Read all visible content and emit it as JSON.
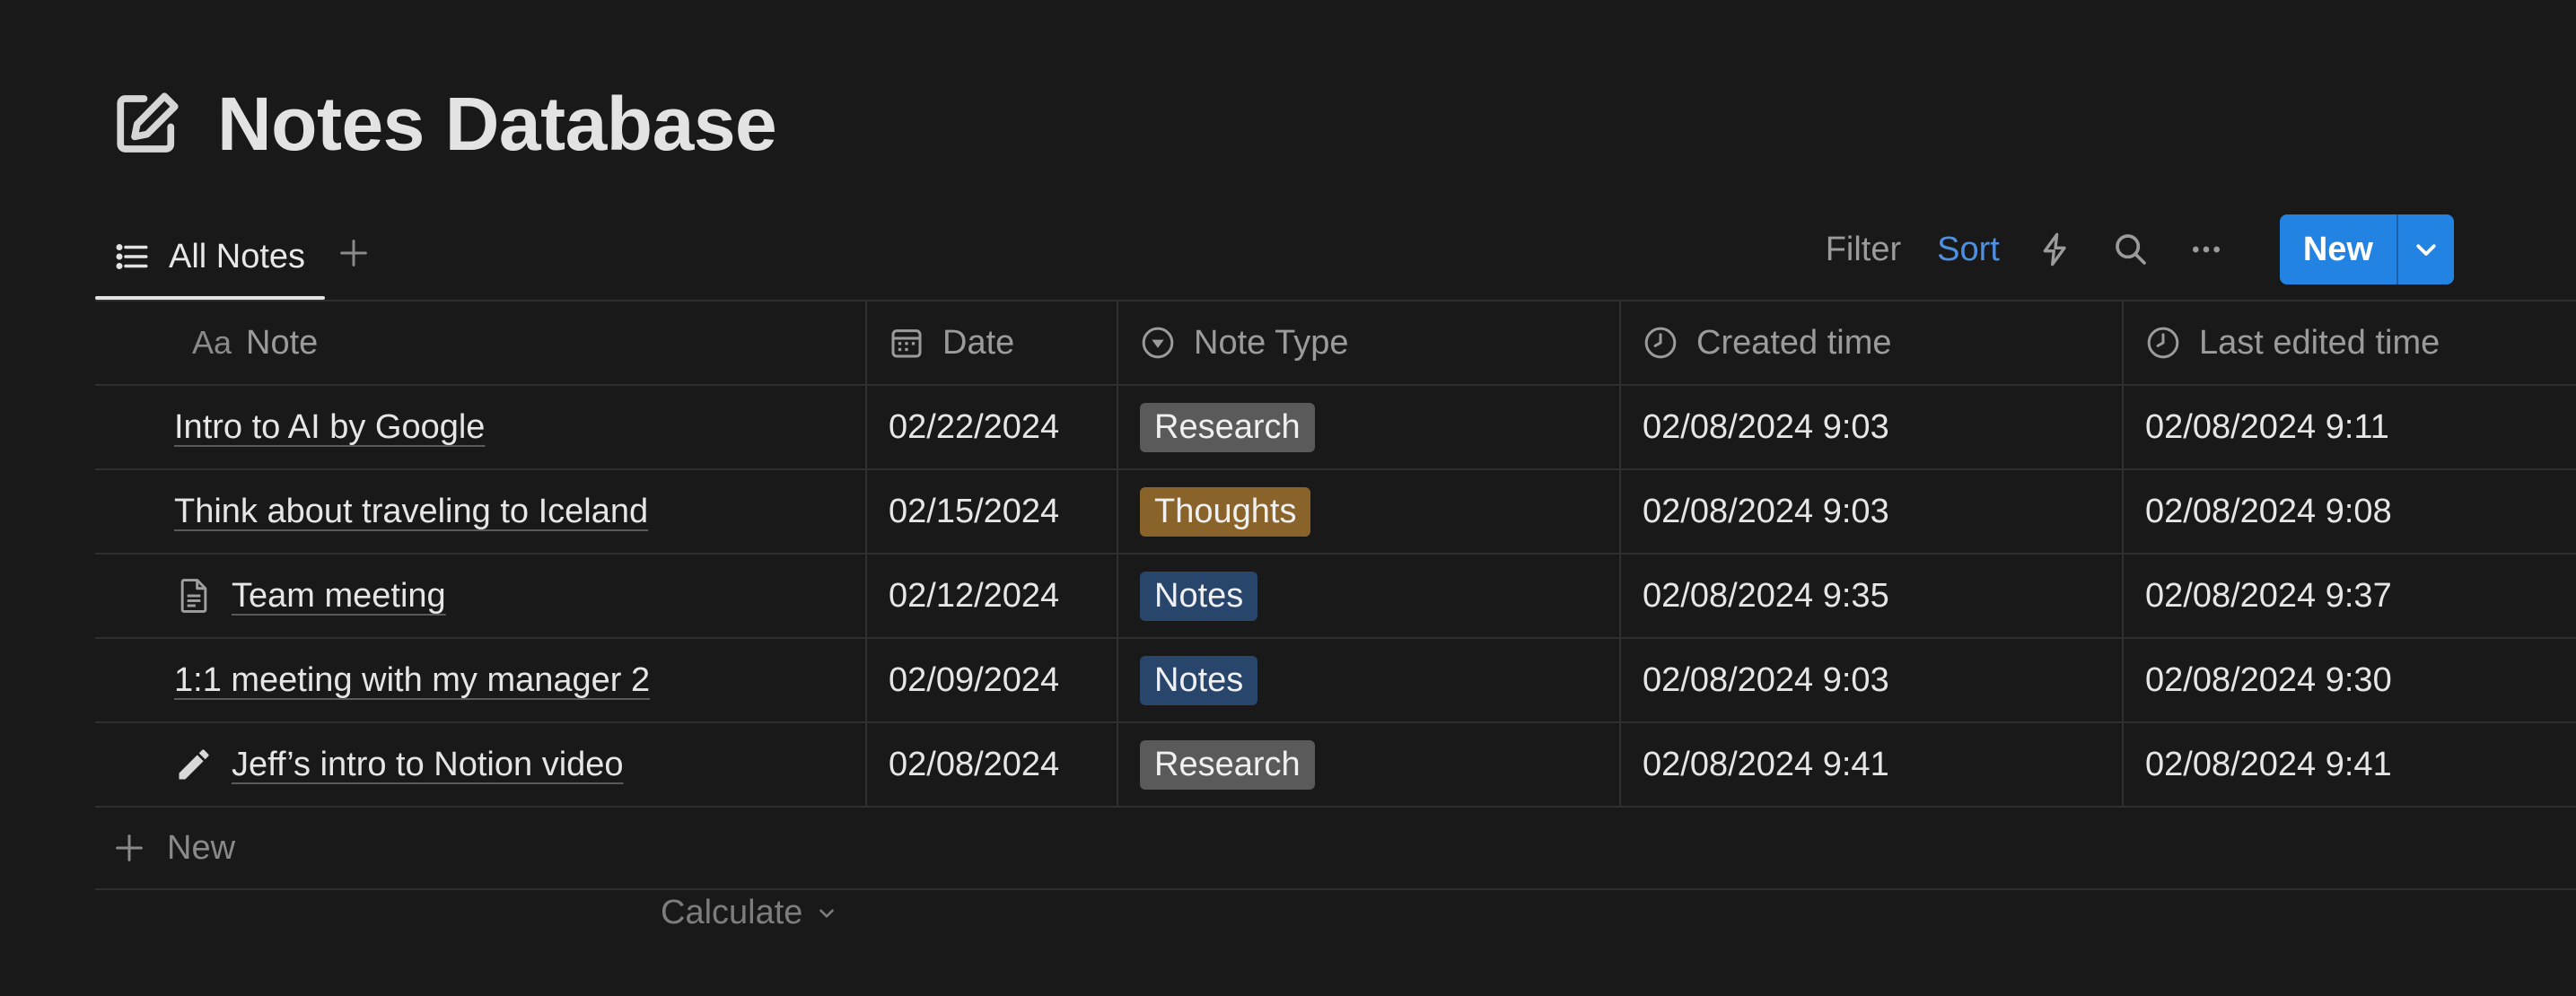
{
  "page": {
    "title": "Notes Database",
    "icon": "edit-note-icon"
  },
  "views": {
    "tabs": [
      {
        "label": "All Notes",
        "icon": "list-icon"
      }
    ],
    "add_view_icon": "plus-icon"
  },
  "toolbar": {
    "filter_label": "Filter",
    "sort_label": "Sort",
    "automation_icon": "lightning-icon",
    "search_icon": "search-icon",
    "more_icon": "ellipsis-icon",
    "new_label": "New",
    "new_menu_icon": "chevron-down-icon",
    "accent_color": "#2383e2",
    "sort_color": "#4f8fe0"
  },
  "table": {
    "columns": [
      {
        "label": "Note",
        "prefix": "Aa"
      },
      {
        "label": "Date",
        "icon": "calendar-icon"
      },
      {
        "label": "Note Type",
        "icon": "select-icon"
      },
      {
        "label": "Created time",
        "icon": "clock-icon"
      },
      {
        "label": "Last edited time",
        "icon": "clock-icon"
      }
    ],
    "rows": [
      {
        "note": "Intro to AI by Google",
        "icon": "",
        "date": "02/22/2024",
        "type": "Research",
        "created": "02/08/2024 9:03",
        "edited": "02/08/2024 9:11"
      },
      {
        "note": "Think about traveling to Iceland",
        "icon": "",
        "date": "02/15/2024",
        "type": "Thoughts",
        "created": "02/08/2024 9:03",
        "edited": "02/08/2024 9:08"
      },
      {
        "note": "Team meeting",
        "icon": "document-icon",
        "date": "02/12/2024",
        "type": "Notes",
        "created": "02/08/2024 9:35",
        "edited": "02/08/2024 9:37"
      },
      {
        "note": "1:1 meeting with my manager 2",
        "icon": "",
        "date": "02/09/2024",
        "type": "Notes",
        "created": "02/08/2024 9:03",
        "edited": "02/08/2024 9:30"
      },
      {
        "note": "Jeff’s intro to Notion video",
        "icon": "pencil-icon",
        "date": "02/08/2024",
        "type": "Research",
        "created": "02/08/2024 9:41",
        "edited": "02/08/2024 9:41"
      }
    ],
    "tag_colors": {
      "Research": "#5a5a5a",
      "Thoughts": "#89632a",
      "Notes": "#28456c"
    },
    "new_row_label": "New",
    "calculate_label": "Calculate"
  }
}
